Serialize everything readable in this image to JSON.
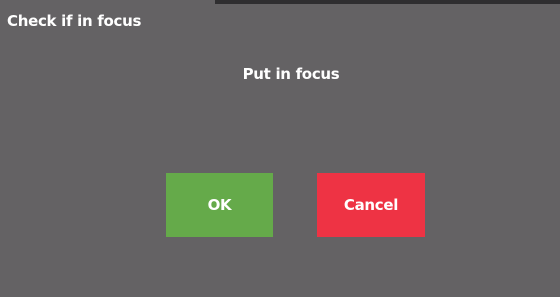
{
  "dialog": {
    "title": "Check if in focus",
    "message": "Put in focus",
    "ok_label": "OK",
    "cancel_label": "Cancel"
  },
  "colors": {
    "background": "#646264",
    "ok_button": "#65aa4a",
    "cancel_button": "#ee3344",
    "text": "#ffffff"
  }
}
